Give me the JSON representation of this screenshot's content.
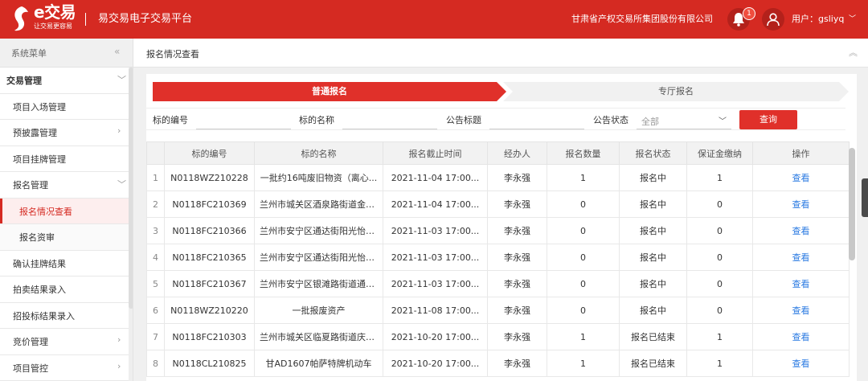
{
  "header": {
    "logo_text": "e交易",
    "logo_slogan": "让交易更容易",
    "platform_title": "易交易电子交易平台",
    "company": "甘肃省产权交易所集团股份有限公司",
    "notification_count": "1",
    "user_label": "用户：gsliyq",
    "brand_color": "#d52a22"
  },
  "sidebar": {
    "title": "系统菜单",
    "collapse_icon": "«",
    "items": [
      {
        "label": "交易管理",
        "type": "group",
        "arrow": "﹀"
      },
      {
        "label": "项目入场管理",
        "type": "item",
        "arrow": ""
      },
      {
        "label": "预披露管理",
        "type": "item",
        "arrow": "›"
      },
      {
        "label": "项目挂牌管理",
        "type": "item",
        "arrow": ""
      },
      {
        "label": "报名管理",
        "type": "item",
        "arrow": "﹀"
      },
      {
        "label": "报名情况查看",
        "type": "sub active",
        "arrow": ""
      },
      {
        "label": "报名资审",
        "type": "sub",
        "arrow": ""
      },
      {
        "label": "确认挂牌结果",
        "type": "item",
        "arrow": ""
      },
      {
        "label": "拍卖结果录入",
        "type": "item",
        "arrow": ""
      },
      {
        "label": "招投标结果录入",
        "type": "item",
        "arrow": ""
      },
      {
        "label": "竞价管理",
        "type": "item",
        "arrow": "›"
      },
      {
        "label": "项目管控",
        "type": "item",
        "arrow": "›"
      }
    ]
  },
  "main": {
    "breadcrumb": "报名情况查看",
    "steps": {
      "step1": "普通报名",
      "step2": "专厅报名"
    },
    "filters": {
      "code_label": "标的编号",
      "name_label": "标的名称",
      "notice_label": "公告标题",
      "status_label": "公告状态",
      "status_value": "全部",
      "query_button": "查询"
    },
    "table": {
      "headers": [
        "",
        "标的编号",
        "标的名称",
        "报名截止时间",
        "经办人",
        "报名数量",
        "报名状态",
        "保证金缴纳",
        "操作"
      ],
      "rows": [
        [
          "1",
          "N0118WZ210228",
          "一批约16吨废旧物资（离心...",
          "2021-11-04 17:00...",
          "李永强",
          "1",
          "报名中",
          "1",
          "查看"
        ],
        [
          "2",
          "N0118FC210369",
          "兰州市城关区酒泉路街道金昌...",
          "2021-11-04 17:00...",
          "李永强",
          "0",
          "报名中",
          "0",
          "查看"
        ],
        [
          "3",
          "N0118FC210366",
          "兰州市安宁区通达街阳光怡园...",
          "2021-11-03 17:00...",
          "李永强",
          "0",
          "报名中",
          "0",
          "查看"
        ],
        [
          "4",
          "N0118FC210365",
          "兰州市安宁区通达街阳光怡园...",
          "2021-11-03 17:00...",
          "李永强",
          "0",
          "报名中",
          "0",
          "查看"
        ],
        [
          "5",
          "N0118FC210367",
          "兰州市安宁区银滩路街道通达...",
          "2021-11-03 17:00...",
          "李永强",
          "0",
          "报名中",
          "0",
          "查看"
        ],
        [
          "6",
          "N0118WZ210220",
          "一批报废资产",
          "2021-11-08 17:00...",
          "李永强",
          "0",
          "报名中",
          "0",
          "查看"
        ],
        [
          "7",
          "N0118FC210303",
          "兰州市城关区临夏路街道庆阳...",
          "2021-10-20 17:00...",
          "李永强",
          "1",
          "报名已结束",
          "1",
          "查看"
        ],
        [
          "8",
          "N0118CL210825",
          "甘AD1607帕萨特牌机动车",
          "2021-10-20 17:00...",
          "李永强",
          "1",
          "报名已结束",
          "1",
          "查看"
        ]
      ]
    }
  }
}
